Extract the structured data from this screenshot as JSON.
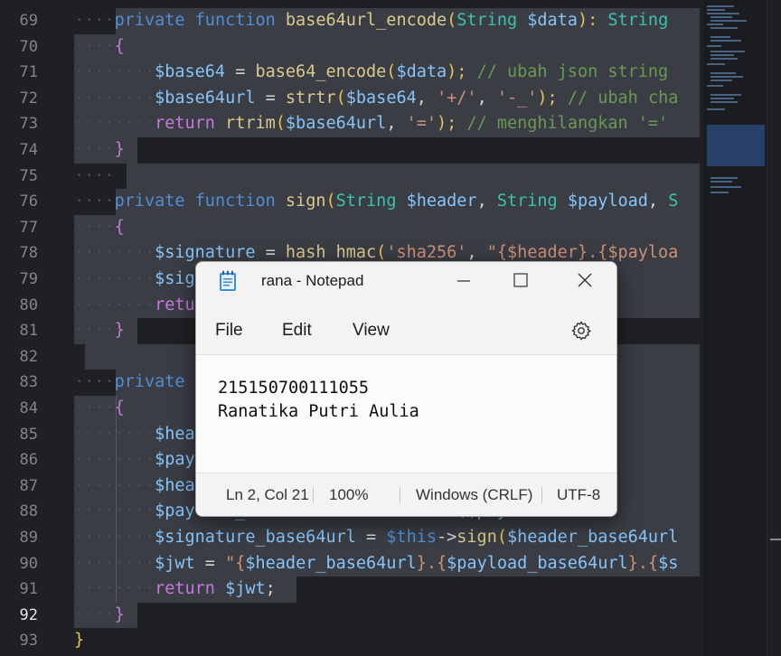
{
  "editor": {
    "line_numbers": [
      "69",
      "70",
      "71",
      "72",
      "73",
      "74",
      "75",
      "76",
      "77",
      "78",
      "79",
      "80",
      "81",
      "82",
      "83",
      "84",
      "85",
      "86",
      "87",
      "88",
      "89",
      "90",
      "91",
      "92",
      "93"
    ],
    "active_line": "92",
    "indent_dots": "····",
    "code": {
      "l69": {
        "kw1": "private",
        "kw2": "function",
        "fn": "base64url_encode",
        "p1": "(",
        "ty": "String",
        "v": "$data",
        "p2": "):",
        "ty2": "String"
      },
      "l70": {
        "b": "{"
      },
      "l71": {
        "v": "$base64",
        "op": " = ",
        "fn": "base64_encode",
        "p1": "(",
        "v2": "$data",
        "p2": ");",
        "cm": "// ubah json string"
      },
      "l72": {
        "v": "$base64url",
        "op": " = ",
        "fn": "strtr",
        "p1": "(",
        "v2": "$base64",
        ", ": ", ",
        "s1": "'+/'",
        "s2": "'-_'",
        "p2": ");",
        "cm": "// ubah cha"
      },
      "l73": {
        "kw": "return",
        "fn": "rtrim",
        "p1": "(",
        "v": "$base64url",
        "s": "'='",
        "p2": ");",
        "cm": "// menghilangkan '='"
      },
      "l74": {
        "b": "}"
      },
      "l76": {
        "kw1": "private",
        "kw2": "function",
        "fn": "sign",
        "p1": "(",
        "ty": "String",
        "v": "$header",
        "ty2": "String",
        "v2": "$payload",
        "tail": "S"
      },
      "l77": {
        "b": "{"
      },
      "l78": {
        "v": "$signature",
        "op": " = ",
        "fn": "hash_hmac",
        "s": "'sha256'",
        "tail": "\"{$header}.{$payloa"
      },
      "l79": {
        "v": "$sig",
        "tail": "de($sign"
      },
      "l80": {
        "kw": "retu"
      },
      "l81": {
        "b": "}"
      },
      "l83": {
        "kw": "private",
        "tail1": "ad,",
        "ty": "Stri"
      },
      "l84": {
        "b": "{"
      },
      "l85": {
        "v": "$hea"
      },
      "l86": {
        "v": "$pay"
      },
      "l87": {
        "v": "$hea",
        "tail": "$header_"
      },
      "l88": {
        "v": "$payload_base64url",
        "tail": "($payloa"
      },
      "l89": {
        "v": "$signature_base64url",
        "op": " = ",
        "v2": "$this",
        "arrow": "->",
        "fn": "sign",
        "p1": "(",
        "v3": "$header_base64url"
      },
      "l90": {
        "v": "$jwt",
        "op": " = ",
        "s1": "\"{",
        "v2": "$header_base64url",
        "s2": "}.{",
        "v3": "$payload_base64url",
        "s3": "}.{",
        "v4": "$s"
      },
      "l91": {
        "kw": "return",
        "v": "$jwt",
        "p": ";"
      },
      "l92": {
        "b": "}"
      },
      "l93": {
        "b": "}"
      }
    }
  },
  "notepad": {
    "title": "rana - Notepad",
    "menu": [
      "File",
      "Edit",
      "View"
    ],
    "content_lines": [
      "215150700111055",
      "Ranatika Putri Aulia"
    ],
    "status": {
      "position": "Ln 2, Col 21",
      "zoom": "100%",
      "line_ending": "Windows (CRLF)",
      "encoding": "UTF-8"
    },
    "icons": {
      "app": "notepad-icon",
      "minimize": "minimize-icon",
      "maximize": "maximize-icon",
      "close": "close-icon",
      "settings": "gear-icon"
    }
  },
  "colors": {
    "editor_bg": "#1f2023",
    "selection": "#3a3d44",
    "keyword": "#4f8fd6",
    "function": "#dcc98f",
    "type": "#3dc2b0",
    "variable": "#86c4fa",
    "string": "#ce9178",
    "comment": "#6a9955"
  }
}
